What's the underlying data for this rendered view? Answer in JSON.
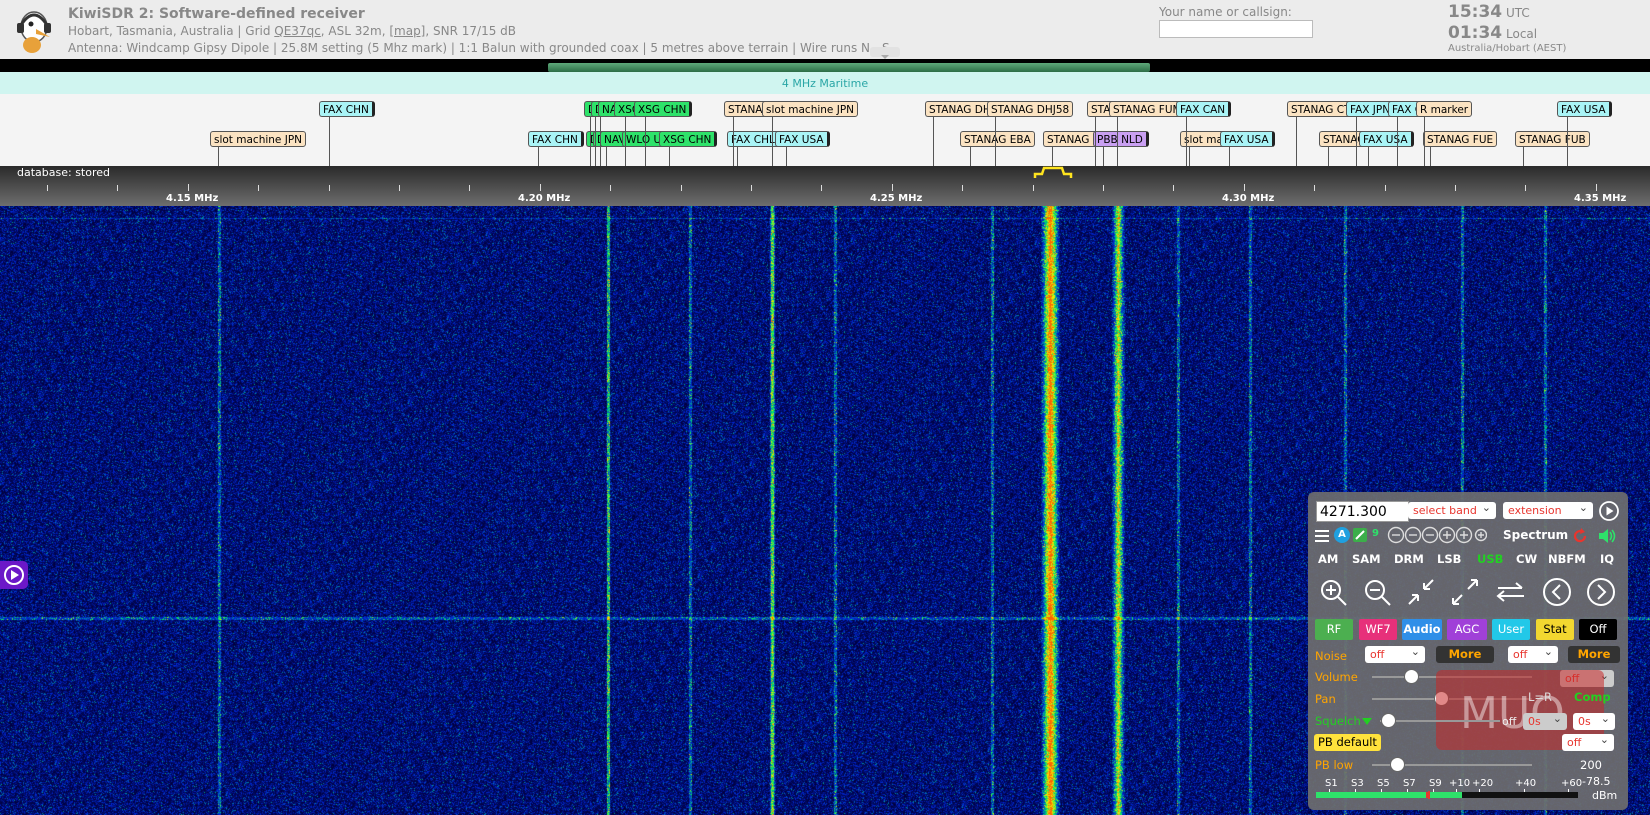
{
  "header": {
    "title": "KiwiSDR 2: Software-defined receiver",
    "location_text": "Hobart, Tasmania, Australia | Grid ",
    "grid": "QE37qc",
    "asl_text": ", ASL 32m, ",
    "map_link": "[map]",
    "snr_text": ", SNR 17/15 dB",
    "antenna": "Antenna: Windcamp Gipsy Dipole | 25.8M setting (5 Mhz mark) | 1:1 Balun with grounded coax | 5 metres above terrain | Wire runs N - S",
    "callsign_label": "Your name or callsign:",
    "callsign_value": "",
    "utc_time": "15:34",
    "utc_label": "UTC",
    "local_time": "01:34",
    "local_label": "Local",
    "timezone": "Australia/Hobart (AEST)"
  },
  "band": {
    "label": "4 MHz Maritime"
  },
  "dx_labels": {
    "row1": [
      "FAX CHN",
      "D",
      "D",
      "NAV",
      "XSG",
      "XSG CHN",
      "STANAG",
      "slot machine JPN",
      "STANAG DHJ",
      "STANAG DHJ58",
      "STA",
      "STANAG FUM",
      "FAX CAN",
      "STANAG CTA",
      "FAX JPN",
      "FAX C",
      "R marker",
      "FAX USA"
    ],
    "row2": [
      "slot machine JPN",
      "FAX CHN",
      "D",
      "D",
      "NAV",
      "WLO US",
      "XSG CHN",
      "FAX CHL",
      "FAX USA",
      "STANAG EBA",
      "STANAG F",
      "PBB NLD",
      "slot ma",
      "FAX USA",
      "STANAG",
      "FAX USA",
      "STANAG FUE",
      "STANAG FUB"
    ]
  },
  "scale": {
    "database_label": "database: stored",
    "ticks": [
      "4.15 MHz",
      "4.20 MHz",
      "4.25 MHz",
      "4.30 MHz",
      "4.35 MHz"
    ]
  },
  "controls": {
    "frequency": "4271.300",
    "select_band": "select band",
    "extension": "extension",
    "a_badge": "A",
    "nine_badge": "9",
    "spectrum_label": "Spectrum",
    "modes": [
      "AM",
      "SAM",
      "DRM",
      "LSB",
      "USB",
      "CW",
      "NBFM",
      "IQ"
    ],
    "active_mode": "USB",
    "tabs": [
      "RF",
      "WF7",
      "Audio",
      "AGC",
      "User",
      "Stat",
      "Off"
    ],
    "noise_label": "Noise",
    "noise_value": "off",
    "noise_more": "More",
    "noise2_value": "off",
    "noise2_more": "More",
    "volume_label": "Volume",
    "volume_value": "off",
    "pan_label": "Pan",
    "pan_lr": "L=R",
    "comp_label": "Comp",
    "squelch_label": "Squelch",
    "squelch_off": "off",
    "squelch_time1": "0s",
    "squelch_time2": "0s",
    "pb_default": "PB default",
    "pb_select": "off",
    "pb_low_label": "PB low",
    "pb_low_value": "200",
    "smeter_labels": [
      "S1",
      "S3",
      "S5",
      "S7",
      "S9",
      "+10",
      "+20",
      "+40",
      "+60"
    ],
    "dbm_value": "-78.5",
    "dbm_unit": "dBm",
    "watermark": "MUO"
  },
  "colors": {
    "accent_green": "#2ee26a",
    "usb_active": "#22d022",
    "rf_tab": "#4caf50",
    "wf_tab": "#e7307a",
    "audio_tab": "#2f8fe8",
    "agc_tab": "#a040d8",
    "user_tab": "#22c8e8",
    "stat_tab": "#f2d730",
    "off_tab": "#000000"
  },
  "icons": [
    "kiwi-logo-icon",
    "menu-icon",
    "play-circle-icon",
    "zoom-in-icon",
    "zoom-out-icon",
    "shrink-icon",
    "expand-icon",
    "swap-icon",
    "chevron-left-icon",
    "chevron-right-icon",
    "speaker-icon",
    "refresh-icon",
    "triangle-down-icon"
  ]
}
